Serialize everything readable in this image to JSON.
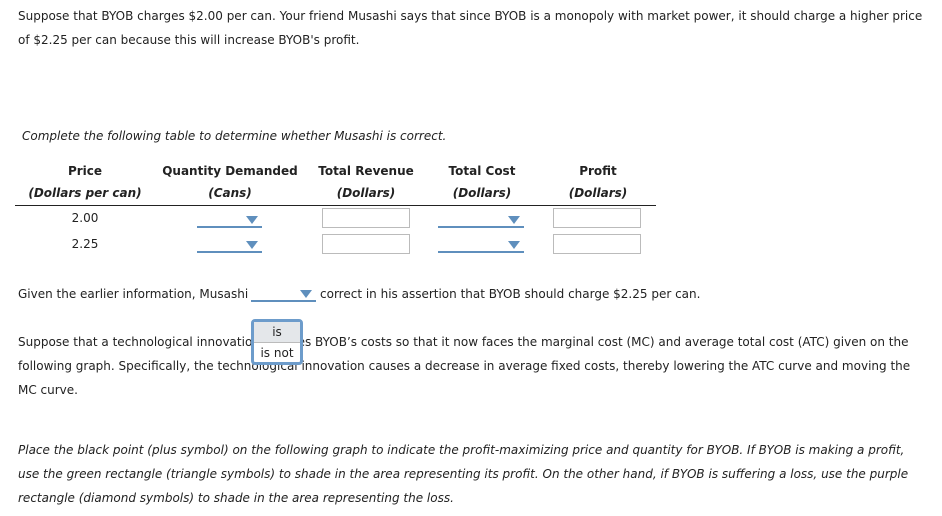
{
  "intro": [
    "Suppose that BYOB charges $2.00 per can. Your friend Musashi says that since BYOB is a monopoly with market power, it should charge a higher price",
    "of $2.25 per can because this will increase BYOB's profit."
  ],
  "table_instruction": "Complete the following table to determine whether Musashi is correct.",
  "table": {
    "headers": [
      {
        "title": "Price",
        "unit": "(Dollars per can)"
      },
      {
        "title": "Quantity Demanded",
        "unit": "(Cans)"
      },
      {
        "title": "Total Revenue",
        "unit": "(Dollars)"
      },
      {
        "title": "Total Cost",
        "unit": "(Dollars)"
      },
      {
        "title": "Profit",
        "unit": "(Dollars)"
      }
    ],
    "rows": [
      {
        "price": "2.00"
      },
      {
        "price": "2.25"
      }
    ]
  },
  "assertion": {
    "before": "Given the earlier information, Musashi",
    "after": "correct in his assertion that BYOB should charge $2.25 per can.",
    "options": [
      "is",
      "is not"
    ]
  },
  "innovation": [
    "Suppose that a technological innovation reduces BYOB’s costs so that it now faces the marginal cost (MC) and average total cost (ATC) given on the",
    "following graph. Specifically, the technological innovation causes a decrease in average fixed costs, thereby lowering the ATC curve and moving the",
    "MC curve."
  ],
  "place": [
    "Place the black point (plus symbol) on the following graph to indicate the profit-maximizing price and quantity for BYOB. If BYOB is making a profit,",
    "use the green rectangle (triangle symbols) to shade in the area representing its profit. On the other hand, if BYOB is suffering a loss, use the purple",
    "rectangle (diamond symbols) to shade in the area representing the loss."
  ]
}
